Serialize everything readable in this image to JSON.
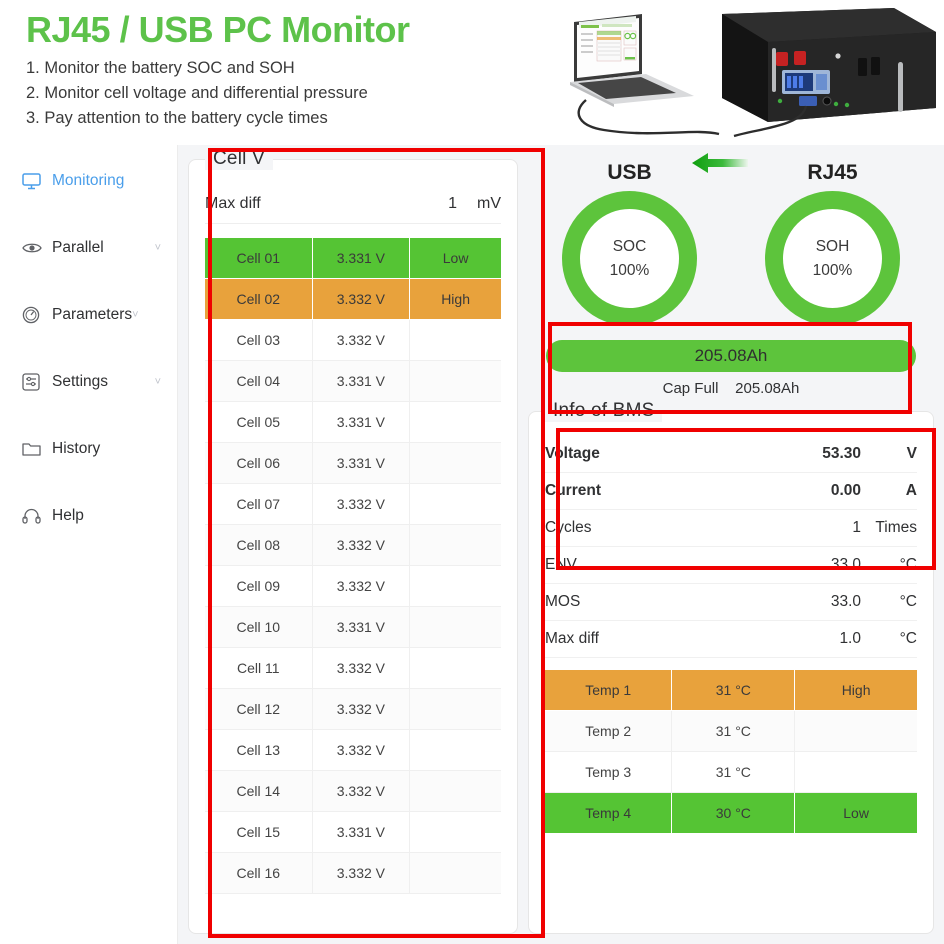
{
  "header": {
    "title": "RJ45 / USB PC Monitor",
    "lines": [
      "1. Monitor the battery SOC and SOH",
      "2. Monitor cell voltage and differential pressure",
      "3. Pay attention to the battery cycle times"
    ],
    "accent_color": "#5dc24a"
  },
  "sidebar": {
    "items": [
      {
        "label": "Monitoring",
        "icon": "monitor-icon",
        "active": true,
        "chevron": ""
      },
      {
        "label": "Parallel",
        "icon": "eye-icon",
        "active": false,
        "chevron": "˅"
      },
      {
        "label": "Parameters",
        "icon": "gauge-icon",
        "active": false,
        "chevron": "˅"
      },
      {
        "label": "Settings",
        "icon": "sliders-icon",
        "active": false,
        "chevron": "˅"
      },
      {
        "label": "History",
        "icon": "folder-icon",
        "active": false,
        "chevron": ""
      },
      {
        "label": "Help",
        "icon": "headset-icon",
        "active": false,
        "chevron": ""
      }
    ],
    "active_color": "#4a9eea"
  },
  "connection": {
    "usb_label": "USB",
    "rj45_label": "RJ45",
    "arrow_icon": "left-arrow-icon",
    "arrow_color": "#17a017"
  },
  "cellv": {
    "legend": "Cell V",
    "maxdiff_label": "Max diff",
    "maxdiff_value": "1",
    "maxdiff_unit": "mV",
    "rows": [
      {
        "name": "Cell 01",
        "value": "3.331 V",
        "status": "Low",
        "state": "low"
      },
      {
        "name": "Cell 02",
        "value": "3.332 V",
        "status": "High",
        "state": "high"
      },
      {
        "name": "Cell 03",
        "value": "3.332 V",
        "status": "",
        "state": ""
      },
      {
        "name": "Cell 04",
        "value": "3.331 V",
        "status": "",
        "state": ""
      },
      {
        "name": "Cell 05",
        "value": "3.331 V",
        "status": "",
        "state": ""
      },
      {
        "name": "Cell 06",
        "value": "3.331 V",
        "status": "",
        "state": ""
      },
      {
        "name": "Cell 07",
        "value": "3.332 V",
        "status": "",
        "state": ""
      },
      {
        "name": "Cell 08",
        "value": "3.332 V",
        "status": "",
        "state": ""
      },
      {
        "name": "Cell 09",
        "value": "3.332 V",
        "status": "",
        "state": ""
      },
      {
        "name": "Cell 10",
        "value": "3.331 V",
        "status": "",
        "state": ""
      },
      {
        "name": "Cell 11",
        "value": "3.332 V",
        "status": "",
        "state": ""
      },
      {
        "name": "Cell 12",
        "value": "3.332 V",
        "status": "",
        "state": ""
      },
      {
        "name": "Cell 13",
        "value": "3.332 V",
        "status": "",
        "state": ""
      },
      {
        "name": "Cell 14",
        "value": "3.332 V",
        "status": "",
        "state": ""
      },
      {
        "name": "Cell 15",
        "value": "3.331 V",
        "status": "",
        "state": ""
      },
      {
        "name": "Cell 16",
        "value": "3.332 V",
        "status": "",
        "state": ""
      }
    ]
  },
  "gauges": [
    {
      "title": "USB",
      "metric": "SOC",
      "value": "100%",
      "color": "#5dc43c"
    },
    {
      "title": "RJ45",
      "metric": "SOH",
      "value": "100%",
      "color": "#5dc43c"
    }
  ],
  "capacity": {
    "bar_value": "205.08Ah",
    "cap_full_label": "Cap Full",
    "cap_full_value": "205.08Ah",
    "bar_color": "#5dc43c"
  },
  "bms": {
    "legend": "Info of BMS",
    "rows": [
      {
        "key": "Voltage",
        "value": "53.30",
        "unit": "V",
        "bold": true
      },
      {
        "key": "Current",
        "value": "0.00",
        "unit": "A",
        "bold": true
      },
      {
        "key": "Cycles",
        "value": "1",
        "unit": "Times",
        "bold": false
      },
      {
        "key": "ENV",
        "value": "33.0",
        "unit": "°C",
        "bold": false
      },
      {
        "key": "MOS",
        "value": "33.0",
        "unit": "°C",
        "bold": false
      },
      {
        "key": "Max diff",
        "value": "1.0",
        "unit": "°C",
        "bold": false
      }
    ],
    "temps": [
      {
        "name": "Temp 1",
        "value": "31 °C",
        "status": "High",
        "state": "high"
      },
      {
        "name": "Temp 2",
        "value": "31 °C",
        "status": "",
        "state": ""
      },
      {
        "name": "Temp 3",
        "value": "31 °C",
        "status": "",
        "state": ""
      },
      {
        "name": "Temp 4",
        "value": "30 °C",
        "status": "Low",
        "state": "low"
      }
    ]
  },
  "colors": {
    "low_green": "#55c434",
    "high_orange": "#e8a23c",
    "annotation_red": "#f00000"
  }
}
